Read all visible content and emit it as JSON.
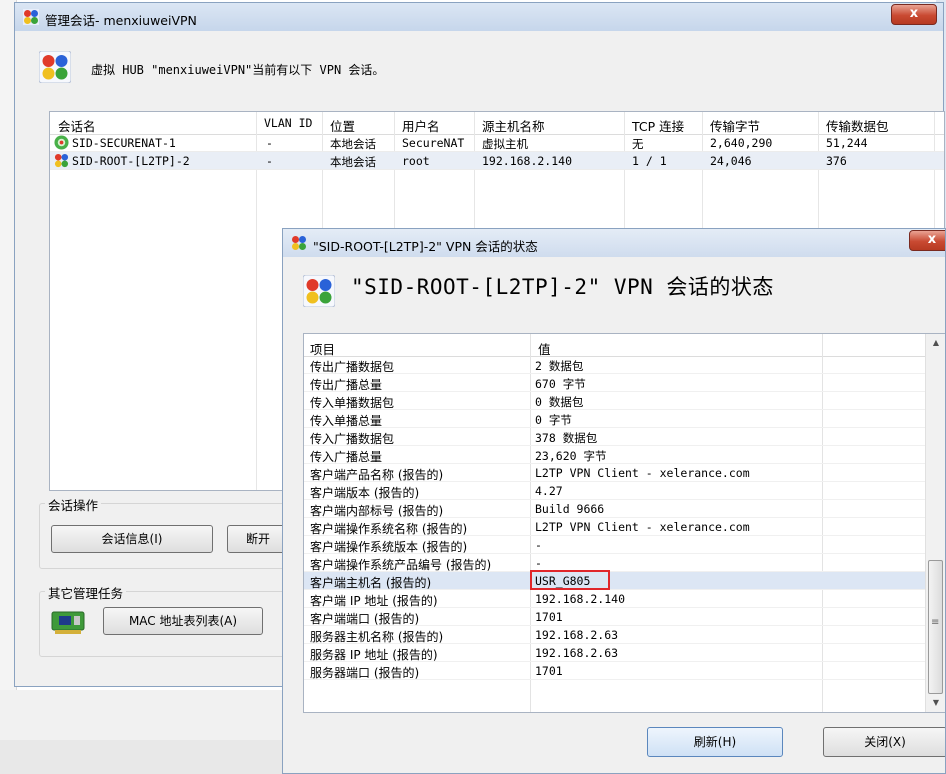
{
  "main_window": {
    "title": "管理会话- menxiuweiVPN",
    "close_glyph": "x",
    "hub_description": "虚拟 HUB \"menxiuweiVPN\"当前有以下 VPN 会话。",
    "columns": [
      "会话名",
      "VLAN ID",
      "位置",
      "用户名",
      "源主机名称",
      "TCP 连接",
      "传输字节",
      "传输数据包"
    ],
    "sessions": [
      {
        "name": "SID-SECURENAT-1",
        "vlan": "-",
        "location": "本地会话",
        "user": "SecureNAT",
        "host": "虚拟主机",
        "tcp": "无",
        "bytes": "2,640,290",
        "packets": "51,244"
      },
      {
        "name": "SID-ROOT-[L2TP]-2",
        "vlan": "-",
        "location": "本地会话",
        "user": "root",
        "host": "192.168.2.140",
        "tcp": "1 / 1",
        "bytes": "24,046",
        "packets": "376"
      }
    ],
    "session_ops_title": "会话操作",
    "session_info_button": "会话信息(I)",
    "disconnect_button": "断开",
    "other_tasks_title": "其它管理任务",
    "mac_table_button": "MAC 地址表列表(A)"
  },
  "dialog": {
    "title": "\"SID-ROOT-[L2TP]-2\" VPN 会话的状态",
    "heading": "\"SID-ROOT-[L2TP]-2\" VPN 会话的状态",
    "close_glyph": "x",
    "columns": [
      "项目",
      "值"
    ],
    "rows": [
      {
        "key": "传出广播数据包",
        "value": "2 数据包"
      },
      {
        "key": "传出广播总量",
        "value": "670 字节"
      },
      {
        "key": "传入单播数据包",
        "value": "0 数据包"
      },
      {
        "key": "传入单播总量",
        "value": "0 字节"
      },
      {
        "key": "传入广播数据包",
        "value": "378 数据包"
      },
      {
        "key": "传入广播总量",
        "value": "23,620 字节"
      },
      {
        "key": "客户端产品名称 (报告的)",
        "value": "L2TP VPN Client - xelerance.com"
      },
      {
        "key": "客户端版本 (报告的)",
        "value": "4.27"
      },
      {
        "key": "客户端内部标号 (报告的)",
        "value": "Build 9666"
      },
      {
        "key": "客户端操作系统名称 (报告的)",
        "value": "L2TP VPN Client - xelerance.com"
      },
      {
        "key": "客户端操作系统版本 (报告的)",
        "value": "-"
      },
      {
        "key": "客户端操作系统产品编号 (报告的)",
        "value": "-"
      },
      {
        "key": "客户端主机名 (报告的)",
        "value": "USR_G805"
      },
      {
        "key": "客户端 IP 地址 (报告的)",
        "value": "192.168.2.140"
      },
      {
        "key": "客户端端口 (报告的)",
        "value": "1701"
      },
      {
        "key": "服务器主机名称 (报告的)",
        "value": "192.168.2.63"
      },
      {
        "key": "服务器 IP 地址 (报告的)",
        "value": "192.168.2.63"
      },
      {
        "key": "服务器端口 (报告的)",
        "value": "1701"
      }
    ],
    "refresh_button": "刷新(H)",
    "close_button": "关闭(X)",
    "scroll_up": "▲",
    "scroll_down": "▼",
    "scroll_grip": "≡"
  },
  "colors": {
    "accent_highlight": "#e0262a",
    "selection": "#dce6f4",
    "title_bar": "#c6d6eb"
  }
}
